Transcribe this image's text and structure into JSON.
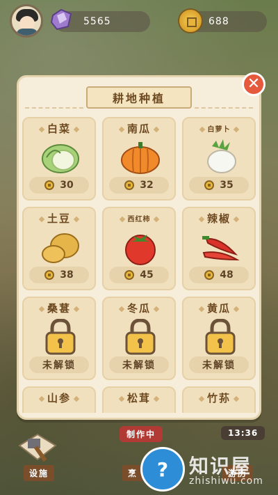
{
  "header": {
    "gems": "5565",
    "coins": "688"
  },
  "modal": {
    "title": "耕地种植",
    "close_label": "✕"
  },
  "crops": [
    {
      "name": "白菜",
      "price": "30",
      "icon": "cabbage-icon"
    },
    {
      "name": "南瓜",
      "price": "32",
      "icon": "pumpkin-icon"
    },
    {
      "name": "白萝卜",
      "price": "35",
      "icon": "radish-icon"
    },
    {
      "name": "土豆",
      "price": "38",
      "icon": "potato-icon"
    },
    {
      "name": "西红柿",
      "price": "45",
      "icon": "tomato-icon"
    },
    {
      "name": "辣椒",
      "price": "48",
      "icon": "chili-icon"
    },
    {
      "name": "桑葚",
      "status": "未解锁",
      "icon": "lock-icon"
    },
    {
      "name": "冬瓜",
      "status": "未解锁",
      "icon": "lock-icon"
    },
    {
      "name": "黄瓜",
      "status": "未解锁",
      "icon": "lock-icon"
    },
    {
      "name": "山参",
      "icon": "lock-icon"
    },
    {
      "name": "松茸",
      "icon": "lock-icon"
    },
    {
      "name": "竹荪",
      "icon": "lock-icon"
    }
  ],
  "bottom": {
    "settings_label": "设施",
    "cooking_status": "制作中",
    "cooking_label": "烹",
    "timer": "13:36",
    "travel_label": "游历",
    "help_label": "?",
    "watermark": "知识屋",
    "watermark_sub": "zhishiwu.com"
  },
  "colors": {
    "accent": "#e55a3c",
    "panel": "#f6eedb",
    "card": "#f1e0bd",
    "text": "#6d4a22"
  }
}
